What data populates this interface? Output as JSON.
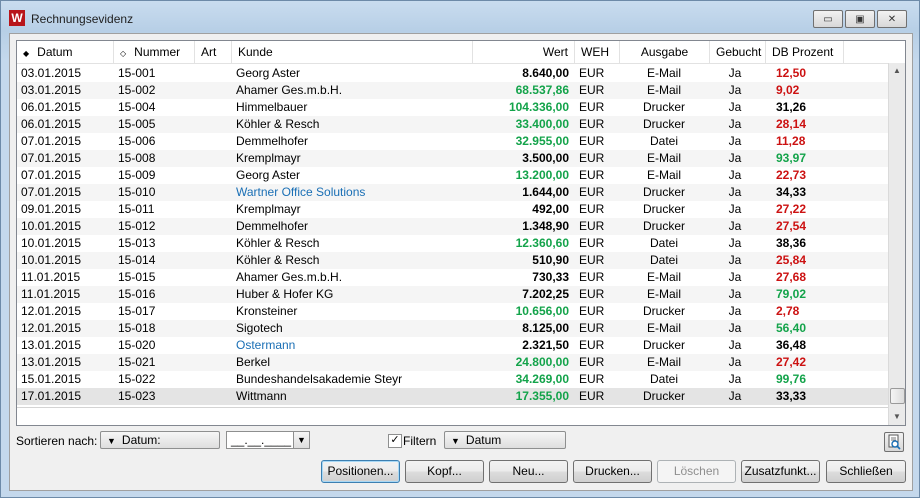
{
  "window": {
    "title": "Rechnungsevidenz",
    "icon_letter": "W",
    "controls": {
      "minimize": "▭",
      "restore": "▣",
      "close": "✕"
    }
  },
  "columns": [
    {
      "key": "datum",
      "label": "Datum",
      "sort": "◆"
    },
    {
      "key": "nummer",
      "label": "Nummer",
      "sort": "◇"
    },
    {
      "key": "art",
      "label": "Art"
    },
    {
      "key": "kunde",
      "label": "Kunde"
    },
    {
      "key": "wert",
      "label": "Wert"
    },
    {
      "key": "weh",
      "label": "WEH"
    },
    {
      "key": "ausgabe",
      "label": "Ausgabe"
    },
    {
      "key": "gebucht",
      "label": "Gebucht"
    },
    {
      "key": "db",
      "label": "DB Prozent"
    }
  ],
  "rows": [
    {
      "datum": "03.01.2015",
      "nummer": "15-001",
      "art": "",
      "kunde": "Georg Aster",
      "kunde_link": false,
      "wert": "8.640,00",
      "wert_color": "black",
      "weh": "EUR",
      "ausgabe": "E-Mail",
      "gebucht": "Ja",
      "db": "12,50",
      "db_color": "red"
    },
    {
      "datum": "03.01.2015",
      "nummer": "15-002",
      "art": "",
      "kunde": "Ahamer Ges.m.b.H.",
      "kunde_link": false,
      "wert": "68.537,86",
      "wert_color": "green",
      "weh": "EUR",
      "ausgabe": "E-Mail",
      "gebucht": "Ja",
      "db": "9,02",
      "db_color": "red"
    },
    {
      "datum": "06.01.2015",
      "nummer": "15-004",
      "art": "",
      "kunde": "Himmelbauer",
      "kunde_link": false,
      "wert": "104.336,00",
      "wert_color": "green",
      "weh": "EUR",
      "ausgabe": "Drucker",
      "gebucht": "Ja",
      "db": "31,26",
      "db_color": "black"
    },
    {
      "datum": "06.01.2015",
      "nummer": "15-005",
      "art": "",
      "kunde": "Köhler & Resch",
      "kunde_link": false,
      "wert": "33.400,00",
      "wert_color": "green",
      "weh": "EUR",
      "ausgabe": "Drucker",
      "gebucht": "Ja",
      "db": "28,14",
      "db_color": "red"
    },
    {
      "datum": "07.01.2015",
      "nummer": "15-006",
      "art": "",
      "kunde": "Demmelhofer",
      "kunde_link": false,
      "wert": "32.955,00",
      "wert_color": "green",
      "weh": "EUR",
      "ausgabe": "Datei",
      "gebucht": "Ja",
      "db": "11,28",
      "db_color": "red"
    },
    {
      "datum": "07.01.2015",
      "nummer": "15-008",
      "art": "",
      "kunde": "Kremplmayr",
      "kunde_link": false,
      "wert": "3.500,00",
      "wert_color": "black",
      "weh": "EUR",
      "ausgabe": "E-Mail",
      "gebucht": "Ja",
      "db": "93,97",
      "db_color": "green"
    },
    {
      "datum": "07.01.2015",
      "nummer": "15-009",
      "art": "",
      "kunde": "Georg Aster",
      "kunde_link": false,
      "wert": "13.200,00",
      "wert_color": "green",
      "weh": "EUR",
      "ausgabe": "E-Mail",
      "gebucht": "Ja",
      "db": "22,73",
      "db_color": "red"
    },
    {
      "datum": "07.01.2015",
      "nummer": "15-010",
      "art": "",
      "kunde": "Wartner Office Solutions",
      "kunde_link": true,
      "wert": "1.644,00",
      "wert_color": "black",
      "weh": "EUR",
      "ausgabe": "Drucker",
      "gebucht": "Ja",
      "db": "34,33",
      "db_color": "black"
    },
    {
      "datum": "09.01.2015",
      "nummer": "15-011",
      "art": "",
      "kunde": "Kremplmayr",
      "kunde_link": false,
      "wert": "492,00",
      "wert_color": "black",
      "weh": "EUR",
      "ausgabe": "Drucker",
      "gebucht": "Ja",
      "db": "27,22",
      "db_color": "red"
    },
    {
      "datum": "10.01.2015",
      "nummer": "15-012",
      "art": "",
      "kunde": "Demmelhofer",
      "kunde_link": false,
      "wert": "1.348,90",
      "wert_color": "black",
      "weh": "EUR",
      "ausgabe": "Drucker",
      "gebucht": "Ja",
      "db": "27,54",
      "db_color": "red"
    },
    {
      "datum": "10.01.2015",
      "nummer": "15-013",
      "art": "",
      "kunde": "Köhler & Resch",
      "kunde_link": false,
      "wert": "12.360,60",
      "wert_color": "green",
      "weh": "EUR",
      "ausgabe": "Datei",
      "gebucht": "Ja",
      "db": "38,36",
      "db_color": "black"
    },
    {
      "datum": "10.01.2015",
      "nummer": "15-014",
      "art": "",
      "kunde": "Köhler & Resch",
      "kunde_link": false,
      "wert": "510,90",
      "wert_color": "black",
      "weh": "EUR",
      "ausgabe": "Datei",
      "gebucht": "Ja",
      "db": "25,84",
      "db_color": "red"
    },
    {
      "datum": "11.01.2015",
      "nummer": "15-015",
      "art": "",
      "kunde": "Ahamer Ges.m.b.H.",
      "kunde_link": false,
      "wert": "730,33",
      "wert_color": "black",
      "weh": "EUR",
      "ausgabe": "E-Mail",
      "gebucht": "Ja",
      "db": "27,68",
      "db_color": "red"
    },
    {
      "datum": "11.01.2015",
      "nummer": "15-016",
      "art": "",
      "kunde": "Huber & Hofer KG",
      "kunde_link": false,
      "wert": "7.202,25",
      "wert_color": "black",
      "weh": "EUR",
      "ausgabe": "E-Mail",
      "gebucht": "Ja",
      "db": "79,02",
      "db_color": "green"
    },
    {
      "datum": "12.01.2015",
      "nummer": "15-017",
      "art": "",
      "kunde": "Kronsteiner",
      "kunde_link": false,
      "wert": "10.656,00",
      "wert_color": "green",
      "weh": "EUR",
      "ausgabe": "Drucker",
      "gebucht": "Ja",
      "db": "2,78",
      "db_color": "red"
    },
    {
      "datum": "12.01.2015",
      "nummer": "15-018",
      "art": "",
      "kunde": "Sigotech",
      "kunde_link": false,
      "wert": "8.125,00",
      "wert_color": "black",
      "weh": "EUR",
      "ausgabe": "E-Mail",
      "gebucht": "Ja",
      "db": "56,40",
      "db_color": "green"
    },
    {
      "datum": "13.01.2015",
      "nummer": "15-020",
      "art": "",
      "kunde": "Ostermann",
      "kunde_link": true,
      "wert": "2.321,50",
      "wert_color": "black",
      "weh": "EUR",
      "ausgabe": "Drucker",
      "gebucht": "Ja",
      "db": "36,48",
      "db_color": "black"
    },
    {
      "datum": "13.01.2015",
      "nummer": "15-021",
      "art": "",
      "kunde": "Berkel",
      "kunde_link": false,
      "wert": "24.800,00",
      "wert_color": "green",
      "weh": "EUR",
      "ausgabe": "E-Mail",
      "gebucht": "Ja",
      "db": "27,42",
      "db_color": "red"
    },
    {
      "datum": "15.01.2015",
      "nummer": "15-022",
      "art": "",
      "kunde": "Bundeshandelsakademie Steyr",
      "kunde_link": false,
      "wert": "34.269,00",
      "wert_color": "green",
      "weh": "EUR",
      "ausgabe": "Datei",
      "gebucht": "Ja",
      "db": "99,76",
      "db_color": "green"
    },
    {
      "datum": "17.01.2015",
      "nummer": "15-023",
      "art": "",
      "kunde": "Wittmann",
      "kunde_link": false,
      "wert": "17.355,00",
      "wert_color": "green",
      "weh": "EUR",
      "ausgabe": "Drucker",
      "gebucht": "Ja",
      "db": "33,33",
      "db_color": "black",
      "selected": true
    }
  ],
  "filters": {
    "sort_label": "Sortieren nach:",
    "sort_value": "Datum:",
    "date_placeholder": "__.__.____",
    "filter_checked": true,
    "filter_label": "Filtern",
    "filter_value": "Datum"
  },
  "buttons": {
    "positionen": "Positionen...",
    "kopf": "Kopf...",
    "neu": "Neu...",
    "drucken": "Drucken...",
    "loeschen": "Löschen",
    "zusatzfunkt": "Zusatzfunkt...",
    "schliessen": "Schließen"
  },
  "colors": {
    "green": "#13a34a",
    "red": "#cc1111",
    "link": "#1a6fb5",
    "selected_row": "#e4e4e4"
  }
}
